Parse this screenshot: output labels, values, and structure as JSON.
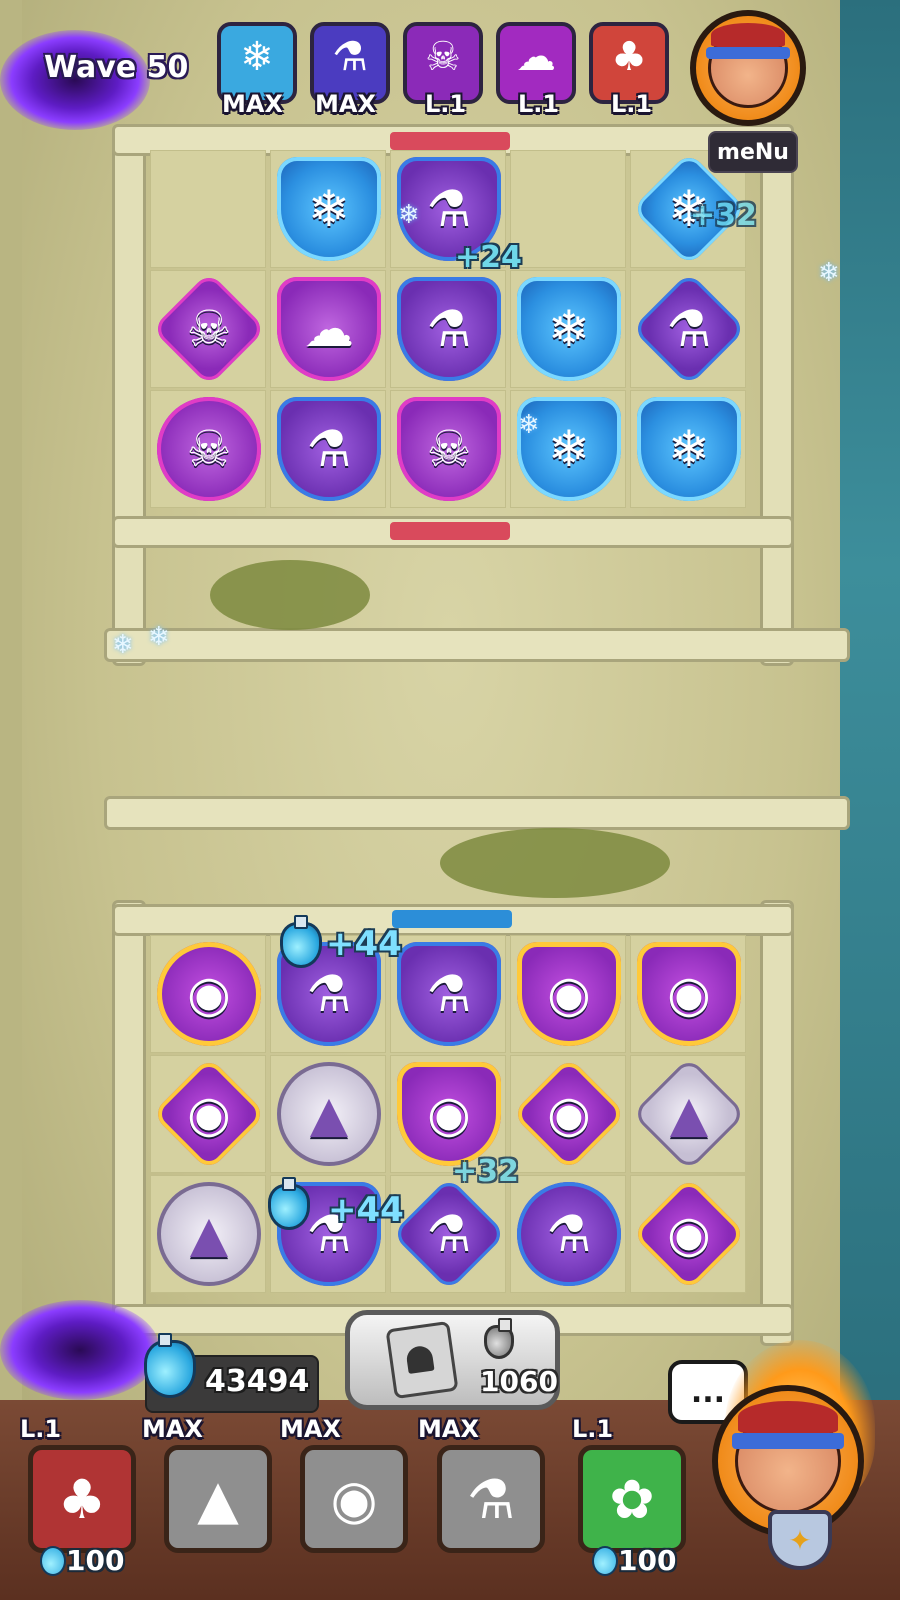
{
  "header": {
    "wave_label": "Wave 50",
    "menu_label": "meNu",
    "opponent_deck": [
      {
        "name": "ice-blade-unit-icon",
        "level": "MAX",
        "color": "#3aa9e0"
      },
      {
        "name": "cauldron-unit-icon",
        "level": "MAX",
        "color": "#4b3cc0"
      },
      {
        "name": "shaman-unit-icon",
        "level": "L.1",
        "color": "#8b2ab8"
      },
      {
        "name": "ghost-unit-icon",
        "level": "L.1",
        "color": "#a22ac0"
      },
      {
        "name": "jester-unit-icon",
        "level": "L.1",
        "color": "#d0453b"
      }
    ]
  },
  "opponent_board": {
    "bonuses": [
      "+24",
      "+32"
    ]
  },
  "player_board": {
    "bonuses": [
      "+44",
      "+32",
      "+44"
    ]
  },
  "mana": {
    "value": "43494"
  },
  "summon": {
    "cost": "1060"
  },
  "chat": {
    "label": "..."
  },
  "player_deck": [
    {
      "name": "jester-unit-icon",
      "level": "L.1",
      "cost": "100",
      "color": "#b03434"
    },
    {
      "name": "eagle-unit-icon",
      "level": "MAX"
    },
    {
      "name": "rogue-unit-icon",
      "level": "MAX"
    },
    {
      "name": "cauldron-unit-icon",
      "level": "MAX"
    },
    {
      "name": "dryad-unit-icon",
      "level": "L.1",
      "cost": "100",
      "color": "#3fb34a"
    }
  ]
}
